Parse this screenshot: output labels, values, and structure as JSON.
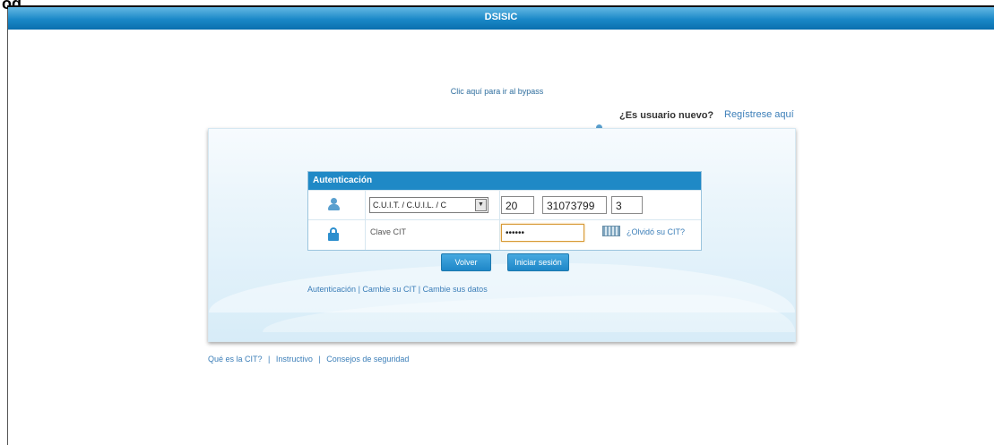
{
  "window": {
    "top_fragment": "og"
  },
  "header": {
    "title": "DSISIC"
  },
  "top": {
    "bypass_link": "Clic aquí para ir al bypass",
    "new_user_question": "¿Es usuario nuevo?",
    "register_link": "Regístrese aquí"
  },
  "auth": {
    "title": "Autenticación",
    "id_type_selected": "C.U.I.T. / C.U.I.L. / C",
    "cuit_prefix": "20",
    "cuit_number": "31073799",
    "cuit_check": "3",
    "password_label": "Clave CIT",
    "password_value": "••••••",
    "forgot_link": "¿Olvidó su CIT?",
    "volver_button": "Volver",
    "login_button": "Iniciar sesión"
  },
  "links": {
    "auth": "Autenticación",
    "change_cit": "Cambie su CIT",
    "change_data": "Cambie sus datos",
    "footer_1": "Qué es la CIT?",
    "footer_2": "Instructivo",
    "footer_3": "Consejos de seguridad",
    "separator": "|"
  },
  "icons": {
    "user": "user-icon",
    "lock": "lock-icon",
    "keyboard": "keyboard-icon",
    "dropdown": "dropdown-arrow-icon"
  },
  "colors": {
    "header_blue": "#1a88c7",
    "link_blue": "#3b7eb8",
    "panel_bg": "#eaf5fb",
    "button_blue": "#1f87c8"
  }
}
